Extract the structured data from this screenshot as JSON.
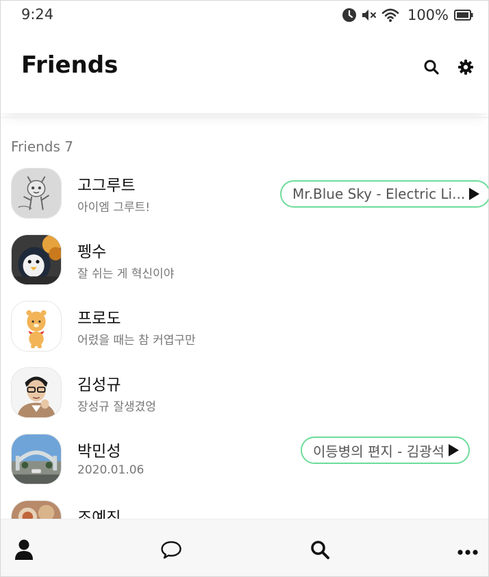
{
  "status_bar": {
    "time": "9:24",
    "battery": "100%",
    "icons": [
      "alarm-icon",
      "mute-icon",
      "wifi-icon",
      "battery-icon"
    ]
  },
  "header": {
    "title": "Friends",
    "actions": [
      "search-icon",
      "gear-icon"
    ]
  },
  "section": {
    "label": "Friends 7"
  },
  "friends": [
    {
      "name": "고그루트",
      "status": "아이엠 그루트!",
      "music": "Mr.Blue Sky - Electric Li...",
      "avatar": "groot-drawing"
    },
    {
      "name": "펭수",
      "status": "잘 쉬는 게 혁신이야",
      "music": null,
      "avatar": "penguin-photo"
    },
    {
      "name": "프로도",
      "status": "어렸을 때는 참 커엽구만",
      "music": null,
      "avatar": "frodo-character"
    },
    {
      "name": "김성규",
      "status": "장성규 잘생겼엉",
      "music": null,
      "avatar": "man-portrait"
    },
    {
      "name": "박민성",
      "status": "2020.01.06",
      "music": "이등병의 편지 - 김광석",
      "avatar": "gate-photo"
    },
    {
      "name": "조예진",
      "status": "",
      "music": null,
      "avatar": "food-photo"
    }
  ],
  "bottom_nav": [
    "person-icon",
    "chat-bubble-icon",
    "search-icon",
    "more-icon"
  ],
  "colors": {
    "accent_green": "#6ddc9a",
    "text_primary": "#111111",
    "text_secondary": "#777777",
    "nav_background": "#f7f7f7"
  }
}
